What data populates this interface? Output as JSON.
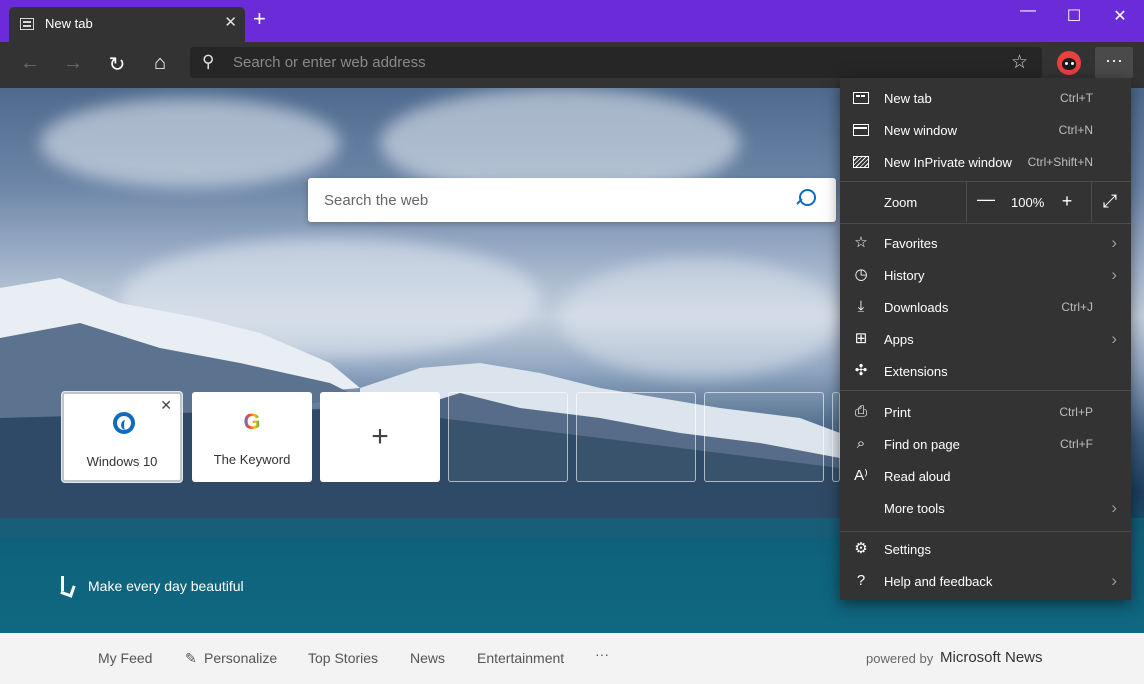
{
  "tab": {
    "title": "New tab",
    "close": "✕",
    "new_tab": "+"
  },
  "window_controls": {
    "minimize": "—",
    "maximize": "☐",
    "close": "✕"
  },
  "toolbar": {
    "back": "←",
    "forward": "→",
    "refresh": "↻",
    "home": "⌂",
    "address_placeholder": "Search or enter web address",
    "search_icon": "⚲",
    "favorite_star": "☆",
    "more": "···"
  },
  "newtab_page": {
    "search_placeholder": "Search the web",
    "tiles": [
      {
        "label": "Windows 10",
        "close": "✕"
      },
      {
        "label": "The Keyword",
        "logo": "G"
      },
      {
        "label": "+"
      }
    ],
    "bing_tagline": "Make every day beautiful"
  },
  "news_bar": {
    "items": [
      "My Feed",
      "Personalize",
      "Top Stories",
      "News",
      "Entertainment",
      "···"
    ],
    "pencil_icon": "✎",
    "powered_by": "powered by",
    "brand": "Microsoft News"
  },
  "menu": {
    "items": [
      {
        "label": "New tab",
        "shortcut": "Ctrl+T"
      },
      {
        "label": "New window",
        "shortcut": "Ctrl+N"
      },
      {
        "label": "New InPrivate window",
        "shortcut": "Ctrl+Shift+N"
      },
      {
        "label": "Favorites",
        "arrow": "›"
      },
      {
        "label": "History",
        "arrow": "›"
      },
      {
        "label": "Downloads",
        "shortcut": "Ctrl+J"
      },
      {
        "label": "Apps",
        "arrow": "›"
      },
      {
        "label": "Extensions"
      },
      {
        "label": "Print",
        "shortcut": "Ctrl+P"
      },
      {
        "label": "Find on page",
        "shortcut": "Ctrl+F"
      },
      {
        "label": "Read aloud"
      },
      {
        "label": "More tools",
        "arrow": "›"
      },
      {
        "label": "Settings"
      },
      {
        "label": "Help and feedback",
        "arrow": "›"
      }
    ],
    "zoom": {
      "label": "Zoom",
      "minus": "—",
      "value": "100%",
      "plus": "+",
      "fullscreen": "⤢"
    },
    "icons": {
      "favorites": "☆",
      "history": "◷",
      "downloads": "⤓",
      "apps": "⊞",
      "extensions": "✣",
      "print": "⎙",
      "find": "⌕",
      "read_aloud": "A⁾",
      "settings": "⚙",
      "help": "?"
    }
  }
}
